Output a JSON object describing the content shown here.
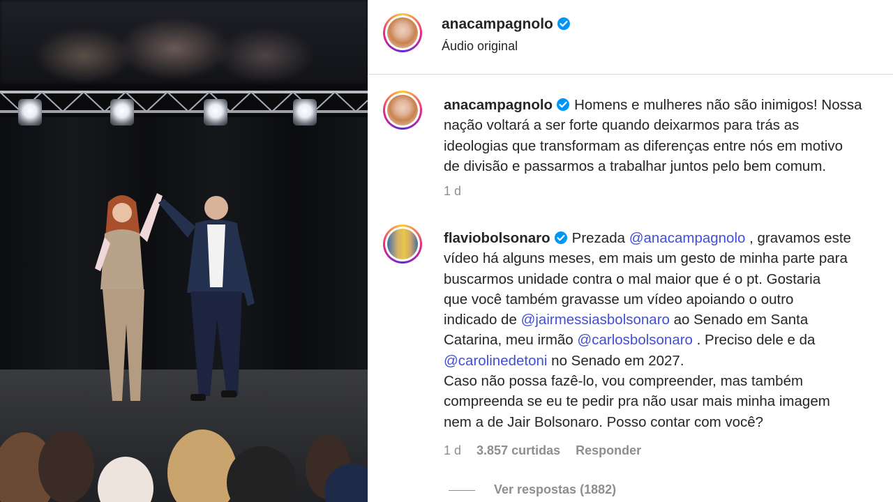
{
  "header": {
    "username": "anacampagnolo",
    "audio_label": "Áudio original"
  },
  "comments": [
    {
      "username": "anacampagnolo",
      "lines": [
        "Homens e mulheres não são inimigos! Nossa",
        "nação voltará a ser forte quando deixarmos para trás as",
        "ideologias que transformam as diferenças entre nós em motivo",
        "de divisão e passarmos a trabalhar juntos pelo bem comum."
      ],
      "time": "1 d"
    },
    {
      "username": "flaviobolsonaro",
      "l1_a": "Prezada ",
      "l1_mention": "@anacampagnolo",
      "l1_b": " , gravamos este",
      "l2": "vídeo há alguns meses, em mais um gesto de minha parte para",
      "l3": "buscarmos unidade contra o mal maior que é o pt. Gostaria",
      "l4": "que você também gravasse um vídeo apoiando o outro",
      "l5_a": "indicado de ",
      "l5_mention": "@jairmessiasbolsonaro",
      "l5_b": " ao Senado em Santa",
      "l6_a": "Catarina, meu irmão ",
      "l6_mention": "@carlosbolsonaro",
      "l6_b": " . Preciso dele e da",
      "l7_mention": "@carolinedetoni",
      "l7_b": " no Senado em 2027.",
      "l8": "Caso não possa fazê-lo, vou compreender, mas também",
      "l9": "compreenda se eu te pedir pra não usar mais minha imagem",
      "l10": "nem a de Jair Bolsonaro. Posso contar com você?",
      "time": "1 d",
      "likes": "3.857 curtidas",
      "reply": "Responder"
    }
  ],
  "view_replies": "Ver respostas (1882)",
  "colors": {
    "mention": "#4150d3",
    "verified": "#0095f6",
    "meta": "#8e8e8e",
    "text": "#262626"
  },
  "icons": [
    "verified-badge-icon"
  ]
}
